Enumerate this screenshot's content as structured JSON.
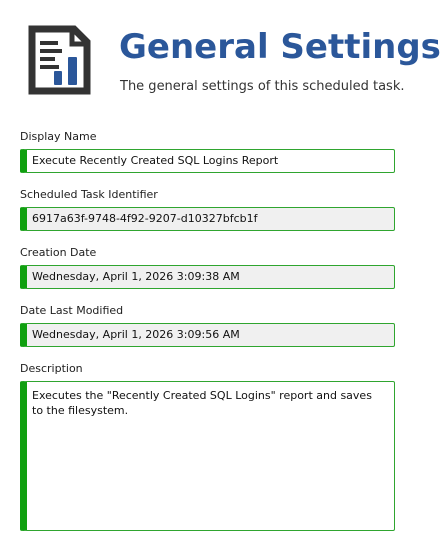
{
  "header": {
    "icon": "report-document-icon",
    "title": "General Settings",
    "subtitle": "The general settings of this scheduled task."
  },
  "fields": {
    "display_name": {
      "label": "Display Name",
      "value": "Execute Recently Created SQL Logins Report"
    },
    "task_identifier": {
      "label": "Scheduled Task Identifier",
      "value": "6917a63f-9748-4f92-9207-d10327bfcb1f"
    },
    "creation_date": {
      "label": "Creation Date",
      "value": "Wednesday, April 1, 2026 3:09:38 AM"
    },
    "date_last_modified": {
      "label": "Date Last Modified",
      "value": "Wednesday, April 1, 2026 3:09:56 AM"
    },
    "description": {
      "label": "Description",
      "value": "Executes the \"Recently Created SQL Logins\" report and saves to the filesystem."
    }
  },
  "colors": {
    "title": "#2b579a",
    "field_accent": "#10a010",
    "field_border": "#2fa52f",
    "readonly_bg": "#f0f0f0",
    "icon_dark": "#333333",
    "icon_chart": "#2b579a"
  }
}
